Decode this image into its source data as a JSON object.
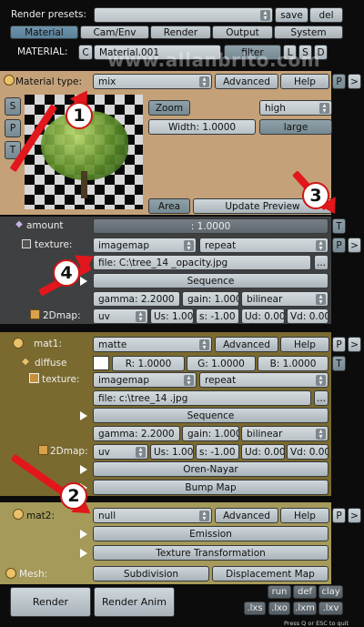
{
  "watermark": "www.allanbrito.com",
  "top": {
    "render_presets_label": "Render presets:",
    "save": "save",
    "del": "del",
    "tabs": [
      "Material",
      "Cam/Env",
      "Render",
      "Output",
      "System"
    ],
    "material_label": "MATERIAL:",
    "c": "C",
    "material_name": "Material.001",
    "filter": "filter",
    "l": "L",
    "s": "S",
    "d": "D"
  },
  "material_type": {
    "label": "Material type:",
    "value": "mix",
    "advanced": "Advanced",
    "help": "Help",
    "p": "P",
    "more": ">"
  },
  "preview": {
    "s": "S",
    "p": "P",
    "t": "T",
    "zoom": "Zoom",
    "quality": "high",
    "width": "Width: 1.0000",
    "large": "large",
    "area": "Area",
    "update": "Update Preview"
  },
  "amount": {
    "label": "amount",
    "value": ": 1.0000",
    "t": "T",
    "texture_label": "texture:",
    "texture_type": "imagemap",
    "repeat": "repeat",
    "p": "P",
    "more": ">",
    "file": "file: C:\\tree_14 _opacity.jpg",
    "browse": "...",
    "sequence": "Sequence",
    "gamma": "gamma: 2.2000",
    "gain": "gain: 1.000",
    "filter": "bilinear",
    "twod_label": "2Dmap:",
    "uv": "uv",
    "us": "Us: 1.00",
    "s": "s: -1.00",
    "ud": "Ud: 0.00",
    "vd": "Vd: 0.00"
  },
  "mat1": {
    "label": "mat1:",
    "value": "matte",
    "advanced": "Advanced",
    "help": "Help",
    "p": "P",
    "more": ">",
    "diffuse_label": "diffuse",
    "r": "R: 1.0000",
    "g": "G: 1.0000",
    "b": "B: 1.0000",
    "t": "T",
    "texture_label": "texture:",
    "texture_type": "imagemap",
    "repeat": "repeat",
    "file": "file: c:\\tree_14 .jpg",
    "browse": "...",
    "sequence": "Sequence",
    "gamma": "gamma: 2.2000",
    "gain": "gain: 1.000",
    "filter": "bilinear",
    "twod_label": "2Dmap:",
    "uv": "uv",
    "us": "Us: 1.00",
    "s": "s: -1.00",
    "ud": "Ud: 0.00",
    "vd": "Vd: 0.00",
    "oren": "Oren-Nayar",
    "bump": "Bump Map"
  },
  "mat2": {
    "label": "mat2:",
    "value": "null",
    "advanced": "Advanced",
    "help": "Help",
    "p": "P",
    "more": ">",
    "emission": "Emission",
    "texture_transformation": "Texture Transformation",
    "mesh_label": "Mesh:",
    "subdivision": "Subdivision",
    "displacement": "Displacement Map"
  },
  "bottom": {
    "render": "Render",
    "render_anim": "Render Anim",
    "run": "run",
    "def": "def",
    "clay": "clay",
    "lxs": ".lxs",
    "lxo": ".lxo",
    "lxm": ".lxm",
    "lxv": ".lxv",
    "quit": "Press Q or ESC to quit"
  },
  "annotations": [
    "1",
    "2",
    "3",
    "4"
  ],
  "colors": {
    "panel_orange": "#c4a178",
    "panel_olive": "#7a6a2f",
    "panel_khaki": "#a59a59",
    "sub_dark": "#3f4042",
    "arrow_red": "#e2161b"
  }
}
